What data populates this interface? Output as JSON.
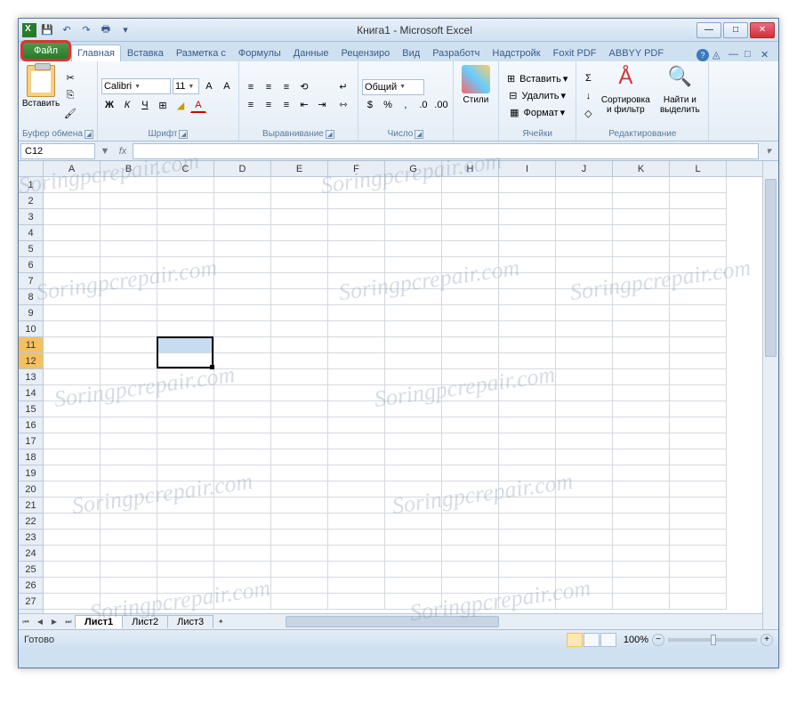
{
  "titlebar": {
    "title": "Книга1 - Microsoft Excel"
  },
  "qat": {
    "save": "💾",
    "undo": "↶",
    "redo": "↷",
    "print": "🖶"
  },
  "win": {
    "min": "—",
    "max": "□",
    "close": "✕"
  },
  "tabs": {
    "file": "Файл",
    "home": "Главная",
    "insert": "Вставка",
    "layout": "Разметка с",
    "formulas": "Формулы",
    "data": "Данные",
    "review": "Рецензиро",
    "view": "Вид",
    "developer": "Разработч",
    "addins": "Надстройк",
    "foxit": "Foxit PDF",
    "abbyy": "ABBYY PDF"
  },
  "ribbon": {
    "clipboard": {
      "paste": "Вставить",
      "label": "Буфер обмена",
      "cut": "✂",
      "copy": "⎘",
      "brush": "🖌"
    },
    "font": {
      "name": "Calibri",
      "size": "11",
      "label": "Шрифт",
      "bold": "Ж",
      "italic": "К",
      "underline": "Ч",
      "border": "⊞",
      "fill": "◢",
      "color": "A",
      "grow": "A",
      "shrink": "A"
    },
    "align": {
      "label": "Выравнивание",
      "tl": "≡",
      "tc": "≡",
      "tr": "≡",
      "ml": "≡",
      "mc": "≡",
      "mr": "≡",
      "wrap": "↵",
      "merge": "⇿",
      "indl": "⇤",
      "indr": "⇥"
    },
    "number": {
      "format": "Общий",
      "label": "Число",
      "cur": "$",
      "pct": "%",
      "comma": ",",
      "inc": ".0",
      "dec": ".00"
    },
    "styles": {
      "btn": "Стили",
      "label": ""
    },
    "cells": {
      "insert": "Вставить",
      "delete": "Удалить",
      "format": "Формат",
      "label": "Ячейки"
    },
    "editing": {
      "sum": "Σ",
      "fill": "↓",
      "clear": "◇",
      "sort": "Сортировка и фильтр",
      "find": "Найти и выделить",
      "label": "Редактирование"
    }
  },
  "formula": {
    "namebox": "C12",
    "fx": "fx"
  },
  "columns": [
    "A",
    "B",
    "C",
    "D",
    "E",
    "F",
    "G",
    "H",
    "I",
    "J",
    "K",
    "L"
  ],
  "rows": [
    "1",
    "2",
    "3",
    "4",
    "5",
    "6",
    "7",
    "8",
    "9",
    "10",
    "11",
    "12",
    "13",
    "14",
    "15",
    "16",
    "17",
    "18",
    "19",
    "20",
    "21",
    "22",
    "23",
    "24",
    "25",
    "26",
    "27"
  ],
  "selected_rows": [
    11,
    12
  ],
  "selection": {
    "col": "C",
    "rows": [
      11,
      12
    ],
    "active_row": 12
  },
  "sheets": {
    "s1": "Лист1",
    "s2": "Лист2",
    "s3": "Лист3"
  },
  "status": {
    "ready": "Готово",
    "zoom": "100%"
  },
  "watermark": "Soringpcrepair.com"
}
